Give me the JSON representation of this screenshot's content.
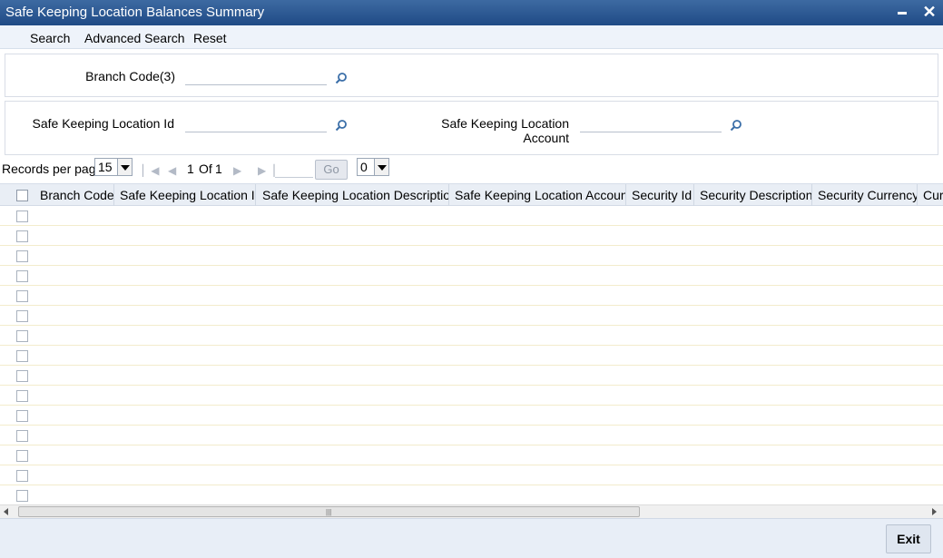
{
  "window": {
    "title": "Safe Keeping Location Balances Summary",
    "minimize_icon": "minimize-icon",
    "close_icon": "close-icon"
  },
  "toolbar": {
    "search": "Search",
    "advanced_search": "Advanced Search",
    "reset": "Reset"
  },
  "criteria": {
    "branch_code_label": "Branch Code(3)",
    "branch_code_value": "",
    "location_id_label": "Safe Keeping Location Id",
    "location_id_value": "",
    "location_account_label_1": "Safe Keeping Location",
    "location_account_label_2": "Account",
    "location_account_value": "",
    "lookup_icon": "search-icon"
  },
  "pager": {
    "records_per_page_label": "Records per page",
    "records_per_page": "15",
    "page_current": "1",
    "page_of": "Of",
    "page_total": "1",
    "go_label": "Go",
    "jump_value": "",
    "page_select": "0"
  },
  "grid": {
    "columns": [
      "Branch Code",
      "Safe Keeping Location Id",
      "Safe Keeping Location Description",
      "Safe Keeping Location Account",
      "Security Id",
      "Security Description",
      "Security Currency",
      "Cur"
    ],
    "row_count": 15
  },
  "footer": {
    "exit": "Exit"
  },
  "colors": {
    "titlebar": "#2b5b95",
    "toolbar": "#eef3fa",
    "header": "#e9eef5",
    "footer": "#e8eef7"
  }
}
